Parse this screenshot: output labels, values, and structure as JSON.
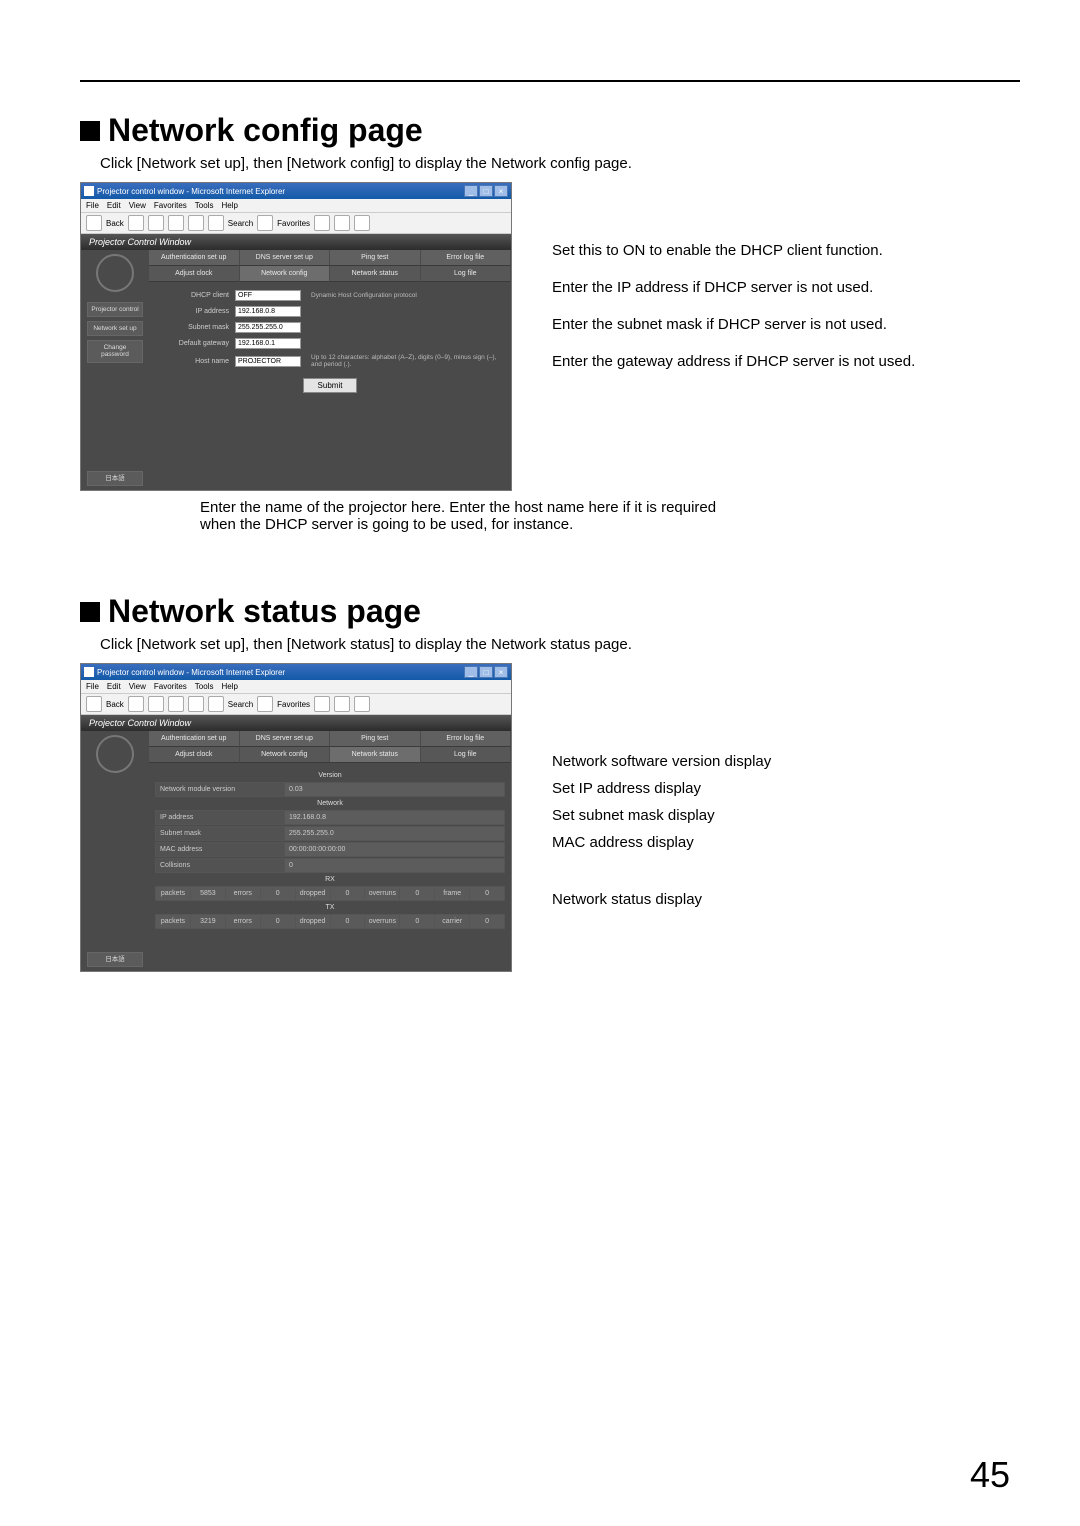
{
  "page_number": "45",
  "section1": {
    "title": "Network config page",
    "intro": "Click [Network set up], then [Network config] to display the Network config page.",
    "window_title": "Projector control window - Microsoft Internet Explorer",
    "menubar": [
      "File",
      "Edit",
      "View",
      "Favorites",
      "Tools",
      "Help"
    ],
    "toolbar": {
      "back": "Back",
      "search": "Search",
      "favorites": "Favorites"
    },
    "pcw_header": "Projector Control Window",
    "sidebar": {
      "projector_control": "Projector control",
      "network_setup": "Network set up",
      "change_password": "Change password",
      "japanese": "日本語"
    },
    "tabs_row1": [
      "Authentication set up",
      "DNS server set up",
      "Ping test",
      "Error log file"
    ],
    "tabs_row2": [
      "Adjust clock",
      "Network config",
      "Network status",
      "Log file"
    ],
    "form": {
      "dhcp": {
        "label": "DHCP client",
        "value": "OFF",
        "hint": "Dynamic Host Configuration protocol"
      },
      "ip": {
        "label": "IP address",
        "value": "192.168.0.8"
      },
      "mask": {
        "label": "Subnet mask",
        "value": "255.255.255.0"
      },
      "gw": {
        "label": "Default gateway",
        "value": "192.168.0.1"
      },
      "host": {
        "label": "Host name",
        "value": "PROJECTOR",
        "hint": "Up to 12 characters: alphabet (A–Z), digits (0–9), minus sign (–), and period (.)."
      },
      "submit": "Submit"
    },
    "callouts": {
      "dhcp": "Set this to ON to enable the DHCP client function.",
      "ip": "Enter the IP address if DHCP server is not used.",
      "mask": "Enter the subnet mask if DHCP server is not used.",
      "gw": "Enter the gateway address if DHCP server is not used."
    },
    "host_caption": "Enter the name of the projector here. Enter the host name here if it is required when the DHCP server is going to be used, for instance."
  },
  "section2": {
    "title": "Network status page",
    "intro": "Click [Network set up], then [Network status] to display the Network status page.",
    "window_title": "Projector control window - Microsoft Internet Explorer",
    "pcw_header": "Projector Control Window",
    "tabs_row1": [
      "Authentication set up",
      "DNS server set up",
      "Ping test",
      "Error log file"
    ],
    "tabs_row2": [
      "Adjust clock",
      "Network config",
      "Network status",
      "Log file"
    ],
    "status": {
      "version_hdr": "Version",
      "version": {
        "label": "Network module version",
        "value": "0.03"
      },
      "network_hdr": "Network",
      "ip": {
        "label": "IP address",
        "value": "192.168.0.8"
      },
      "mask": {
        "label": "Subnet mask",
        "value": "255.255.255.0"
      },
      "mac": {
        "label": "MAC address",
        "value": "00:00:00:00:00:00"
      },
      "coll": {
        "label": "Collisions",
        "value": "0"
      },
      "rx_hdr": "RX",
      "rx": {
        "packets_l": "packets",
        "packets_v": "5853",
        "errors_l": "errors",
        "errors_v": "0",
        "dropped_l": "dropped",
        "dropped_v": "0",
        "overruns_l": "overruns",
        "overruns_v": "0",
        "frame_l": "frame",
        "frame_v": "0"
      },
      "tx_hdr": "TX",
      "tx": {
        "packets_l": "packets",
        "packets_v": "3219",
        "errors_l": "errors",
        "errors_v": "0",
        "dropped_l": "dropped",
        "dropped_v": "0",
        "overruns_l": "overruns",
        "overruns_v": "0",
        "carrier_l": "carrier",
        "carrier_v": "0"
      }
    },
    "callouts": {
      "version": "Network software version display",
      "ip": "Set IP address display",
      "mask": "Set subnet mask display",
      "mac": "MAC address display",
      "net": "Network status display"
    }
  }
}
